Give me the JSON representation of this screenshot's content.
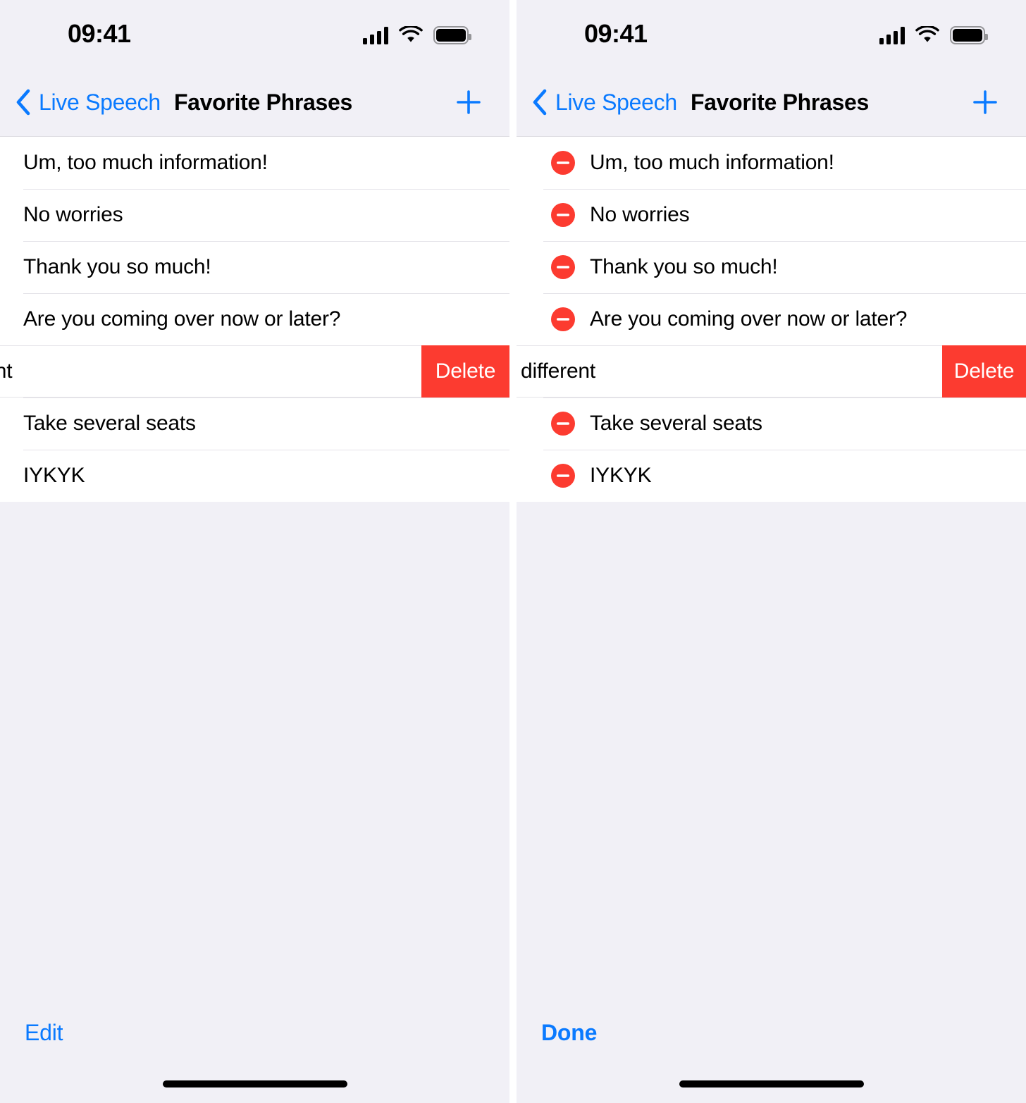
{
  "panels": [
    {
      "id": "left",
      "mode": "browse",
      "status_bar": {
        "time": "09:41",
        "cellular_icon": "cellular-bars-icon",
        "wifi_icon": "wifi-icon",
        "battery_icon": "battery-full-icon"
      },
      "nav": {
        "back_label": "Live Speech",
        "back_icon": "chevron-left-icon",
        "title": "Favorite Phrases",
        "add_icon": "plus-icon"
      },
      "rows": [
        {
          "label": "Um, too much information!",
          "state": "normal"
        },
        {
          "label": "No worries",
          "state": "normal"
        },
        {
          "label": "Thank you so much!",
          "state": "normal"
        },
        {
          "label": "Are you coming over now or later?",
          "state": "normal"
        },
        {
          "label": "erent",
          "state": "swiped",
          "delete_label": "Delete"
        },
        {
          "label": "Take several seats",
          "state": "normal"
        },
        {
          "label": "IYKYK",
          "state": "normal"
        }
      ],
      "toolbar": {
        "button_label": "Edit"
      }
    },
    {
      "id": "right",
      "mode": "editing",
      "status_bar": {
        "time": "09:41",
        "cellular_icon": "cellular-bars-icon",
        "wifi_icon": "wifi-icon",
        "battery_icon": "battery-full-icon"
      },
      "nav": {
        "back_label": "Live Speech",
        "back_icon": "chevron-left-icon",
        "title": "Favorite Phrases",
        "add_icon": "plus-icon"
      },
      "rows": [
        {
          "label": "Um, too much information!",
          "state": "normal",
          "delete_badge_icon": "minus-circle-icon"
        },
        {
          "label": "No worries",
          "state": "normal",
          "delete_badge_icon": "minus-circle-icon"
        },
        {
          "label": "Thank you so much!",
          "state": "normal",
          "delete_badge_icon": "minus-circle-icon"
        },
        {
          "label": "Are you coming over now or later?",
          "state": "normal",
          "delete_badge_icon": "minus-circle-icon"
        },
        {
          "label": "different",
          "state": "swiped",
          "delete_label": "Delete"
        },
        {
          "label": "Take several seats",
          "state": "normal",
          "delete_badge_icon": "minus-circle-icon"
        },
        {
          "label": "IYKYK",
          "state": "normal",
          "delete_badge_icon": "minus-circle-icon"
        }
      ],
      "toolbar": {
        "button_label": "Done"
      }
    }
  ],
  "colors": {
    "accent_blue": "#0A7AFF",
    "destructive_red": "#FC3B30",
    "chrome_background": "#F1F0F6",
    "list_background": "#FFFFFF",
    "separator": "#E4E3E8"
  }
}
